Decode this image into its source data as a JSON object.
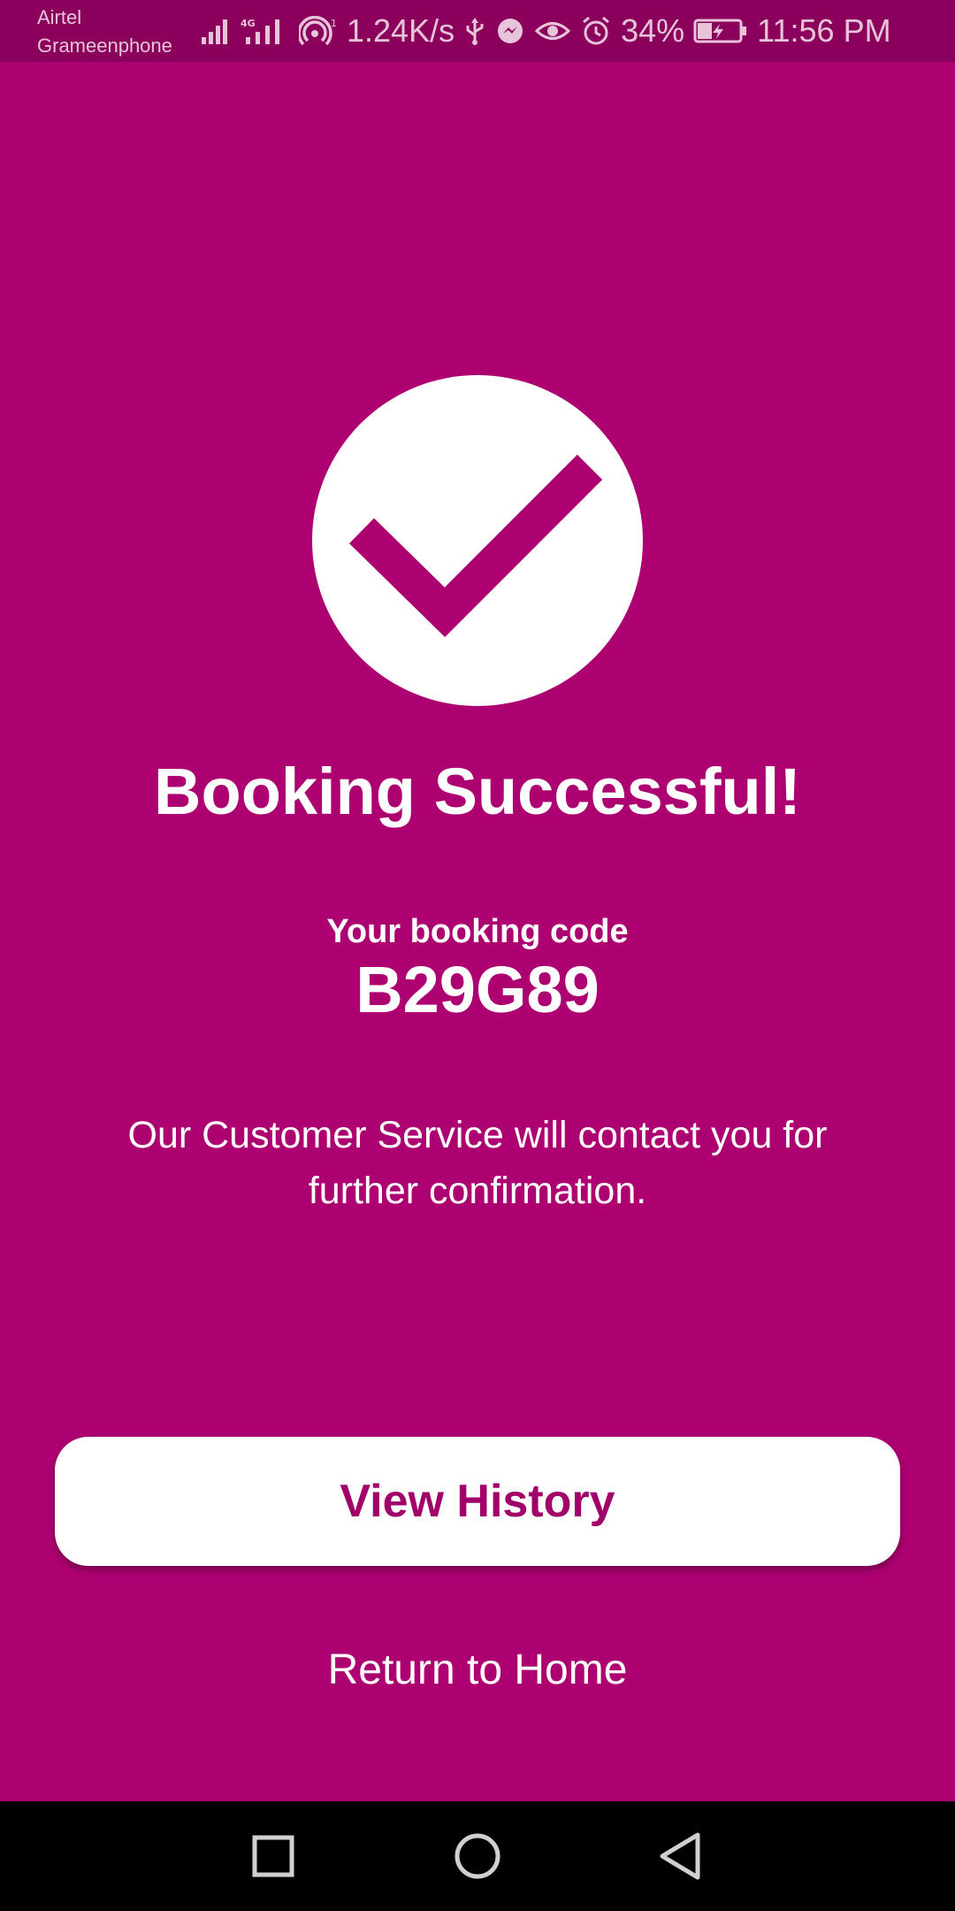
{
  "status_bar": {
    "carrier_1": "Airtel",
    "carrier_2": "Grameenphone",
    "network_speed": "1.24K/s",
    "battery": "34%",
    "time": "11:56 PM",
    "icons": [
      "signal-icon",
      "signal-4g-icon",
      "hotspot-icon",
      "usb-icon",
      "messenger-icon",
      "eye-icon",
      "alarm-icon",
      "battery-charging-icon"
    ]
  },
  "success": {
    "icon": "checkmark-icon",
    "title": "Booking Successful!",
    "code_label": "Your booking code",
    "code": "B29G89",
    "message": "Our Customer Service will contact you for further confirmation."
  },
  "actions": {
    "view_history_label": "View History",
    "return_home_label": "Return to Home"
  },
  "nav_bar": {
    "icons": [
      "recents-icon",
      "home-icon",
      "back-icon"
    ]
  },
  "colors": {
    "background": "#ad0071",
    "status_bar": "#8a005a",
    "accent_text": "#a10069",
    "white": "#ffffff",
    "nav_bar": "#000000"
  }
}
